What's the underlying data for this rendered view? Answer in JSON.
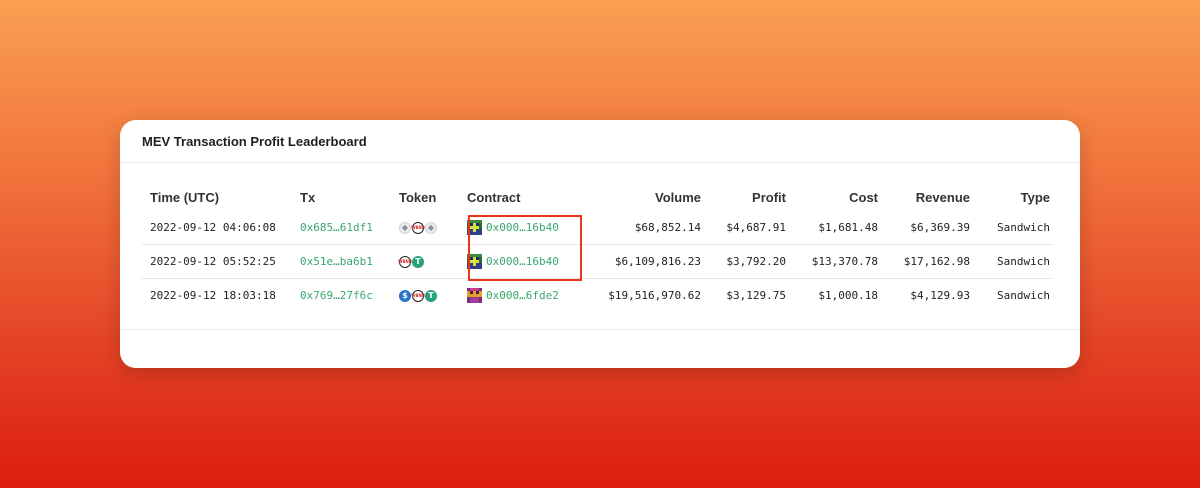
{
  "card": {
    "title": "MEV Transaction Profit Leaderboard"
  },
  "columns": {
    "time": "Time (UTC)",
    "tx": "Tx",
    "token": "Token",
    "contract": "Contract",
    "volume": "Volume",
    "profit": "Profit",
    "cost": "Cost",
    "revenue": "Revenue",
    "type": "Type"
  },
  "rows": [
    {
      "time": "2022-09-12 04:06:08",
      "tx": "0x685…61df1",
      "tokens": [
        "eth-icon",
        "wbnb-icon",
        "eth-icon"
      ],
      "contract": "0x000…16b40",
      "volume": "$68,852.14",
      "profit": "$4,687.91",
      "cost": "$1,681.48",
      "revenue": "$6,369.39",
      "type": "Sandwich"
    },
    {
      "time": "2022-09-12 05:52:25",
      "tx": "0x51e…ba6b1",
      "tokens": [
        "wbnb-icon",
        "tether-icon"
      ],
      "contract": "0x000…16b40",
      "volume": "$6,109,816.23",
      "profit": "$3,792.20",
      "cost": "$13,370.78",
      "revenue": "$17,162.98",
      "type": "Sandwich"
    },
    {
      "time": "2022-09-12 18:03:18",
      "tx": "0x769…27f6c",
      "tokens": [
        "usdc-icon",
        "wbnb-icon",
        "tether-icon"
      ],
      "contract": "0x000…6fde2",
      "volume": "$19,516,970.62",
      "profit": "$3,129.75",
      "cost": "$1,000.18",
      "revenue": "$4,129.93",
      "type": "Sandwich"
    }
  ],
  "tokens_text": {
    "wbnb": "WBNB",
    "tether": "T",
    "usdc": "$",
    "eth": "◆"
  },
  "colors": {
    "link": "#3aa66d",
    "highlight": "#e8341b",
    "tether": "#26a17b",
    "usdc": "#2775ca"
  }
}
